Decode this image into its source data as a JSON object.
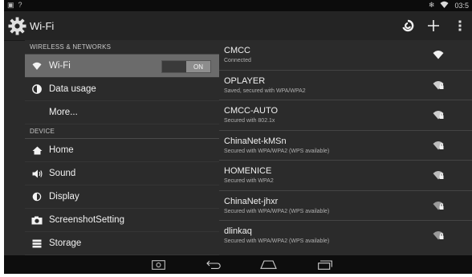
{
  "status": {
    "time": "03:5"
  },
  "header": {
    "title": "Wi-Fi"
  },
  "sections": {
    "wireless": "WIRELESS & NETWORKS",
    "device": "DEVICE"
  },
  "nav": [
    {
      "label": "Wi-Fi",
      "icon": "wifi-icon",
      "toggle": "ON",
      "selected": true
    },
    {
      "label": "Data usage",
      "icon": "data-usage-icon"
    },
    {
      "label": "More..."
    },
    {
      "label": "Home",
      "icon": "home-icon"
    },
    {
      "label": "Sound",
      "icon": "speaker-icon"
    },
    {
      "label": "Display",
      "icon": "display-icon"
    },
    {
      "label": "ScreenshotSetting",
      "icon": "camera-icon"
    },
    {
      "label": "Storage",
      "icon": "storage-icon"
    }
  ],
  "networks": [
    {
      "name": "CMCC",
      "status": "Connected",
      "signal_icon": "wifi-signal-open-icon"
    },
    {
      "name": "OPLAYER",
      "status": "Saved, secured with WPA/WPA2",
      "signal_icon": "wifi-signal-lock-icon"
    },
    {
      "name": "CMCC-AUTO",
      "status": "Secured with 802.1x",
      "signal_icon": "wifi-signal-lock-icon"
    },
    {
      "name": "ChinaNet-kMSn",
      "status": "Secured with WPA/WPA2 (WPS available)",
      "signal_icon": "wifi-signal-lock-icon"
    },
    {
      "name": "HOMENICE",
      "status": "Secured with WPA2",
      "signal_icon": "wifi-signal-lock-icon"
    },
    {
      "name": "ChinaNet-jhxr",
      "status": "Secured with WPA/WPA2 (WPS available)",
      "signal_icon": "wifi-signal-lock-icon"
    },
    {
      "name": "dlinkaq",
      "status": "Secured with WPA/WPA2 (WPS available)",
      "signal_icon": "wifi-signal-lock-icon"
    }
  ]
}
